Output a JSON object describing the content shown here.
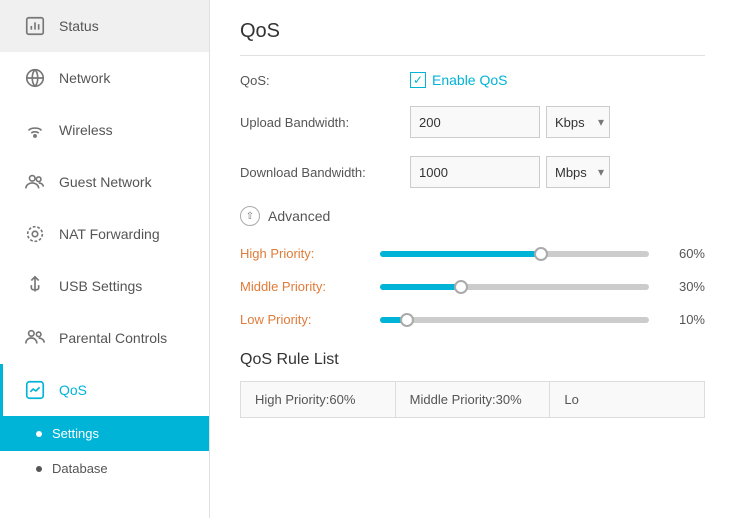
{
  "sidebar": {
    "items": [
      {
        "id": "status",
        "label": "Status",
        "icon": "status-icon"
      },
      {
        "id": "network",
        "label": "Network",
        "icon": "network-icon",
        "active": false
      },
      {
        "id": "wireless",
        "label": "Wireless",
        "icon": "wireless-icon"
      },
      {
        "id": "guest-network",
        "label": "Guest Network",
        "icon": "guest-icon"
      },
      {
        "id": "nat-forwarding",
        "label": "NAT Forwarding",
        "icon": "nat-icon"
      },
      {
        "id": "usb-settings",
        "label": "USB Settings",
        "icon": "usb-icon"
      },
      {
        "id": "parental-controls",
        "label": "Parental Controls",
        "icon": "parental-icon"
      },
      {
        "id": "qos",
        "label": "QoS",
        "icon": "qos-icon",
        "active": true
      }
    ],
    "sub_items": [
      {
        "id": "settings",
        "label": "Settings",
        "active": true
      },
      {
        "id": "database",
        "label": "Database",
        "active": false
      }
    ]
  },
  "main": {
    "title": "QoS",
    "qos_label": "QoS:",
    "enable_qos_label": "Enable QoS",
    "upload_label": "Upload Bandwidth:",
    "upload_value": "200",
    "download_label": "Download Bandwidth:",
    "download_value": "1000",
    "upload_unit": "Kbps",
    "download_unit": "Mbps",
    "unit_options": [
      "Kbps",
      "Mbps"
    ],
    "advanced_label": "Advanced",
    "high_priority_label": "High Priority:",
    "high_priority_percent": "60%",
    "high_priority_value": 60,
    "middle_priority_label": "Middle Priority:",
    "middle_priority_percent": "30%",
    "middle_priority_value": 30,
    "low_priority_label": "Low Priority:",
    "low_priority_percent": "10%",
    "low_priority_value": 10,
    "rule_list_title": "QoS Rule List",
    "rule_cells": [
      "High Priority:60%",
      "Middle Priority:30%",
      "Lo"
    ]
  }
}
